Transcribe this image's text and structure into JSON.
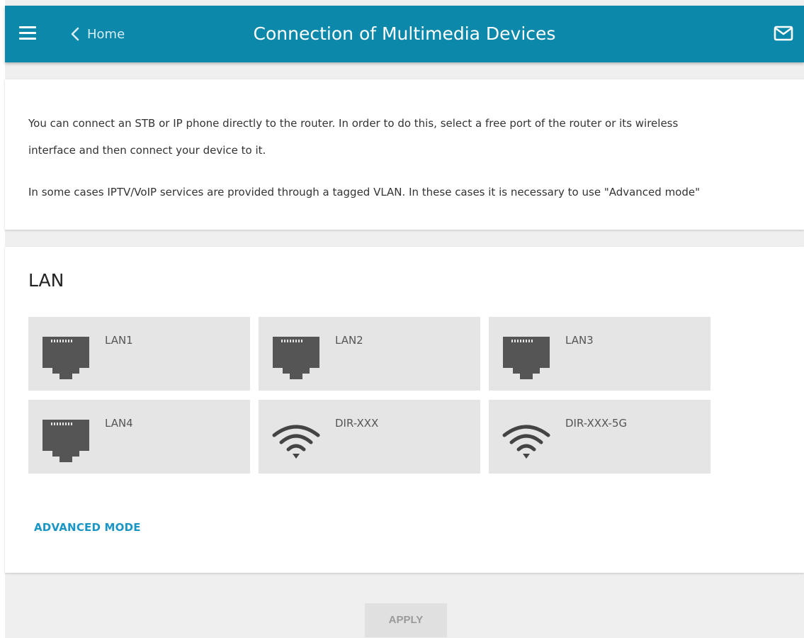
{
  "header": {
    "back_label": "Home",
    "title": "Connection of Multimedia Devices",
    "color": "#0c88ab"
  },
  "intro": {
    "line1": "You can connect an STB or IP phone directly to the router. In order to do this, select a free port of the router or its wireless",
    "line2": "interface and then connect your device to it.",
    "line3": "In some cases IPTV/VoIP services are provided through a tagged VLAN. In these cases it is necessary to use \"Advanced mode\""
  },
  "lan": {
    "title": "LAN",
    "ports": [
      {
        "label": "LAN1",
        "icon": "ethernet-port-icon"
      },
      {
        "label": "LAN2",
        "icon": "ethernet-port-icon"
      },
      {
        "label": "LAN3",
        "icon": "ethernet-port-icon"
      },
      {
        "label": "LAN4",
        "icon": "ethernet-port-icon"
      },
      {
        "label": "DIR-XXX",
        "icon": "wifi-icon"
      },
      {
        "label": "DIR-XXX-5G",
        "icon": "wifi-icon"
      }
    ],
    "advanced_mode_label": "ADVANCED MODE",
    "link_color": "#1a96c6"
  },
  "footer": {
    "apply_label": "APPLY"
  }
}
